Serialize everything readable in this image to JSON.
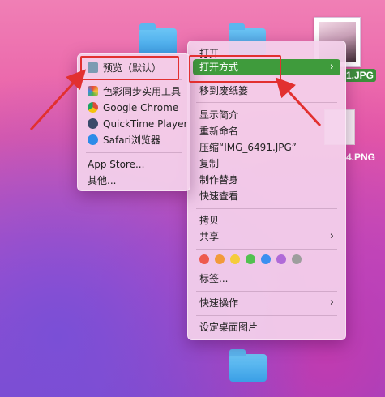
{
  "desktop": {
    "files": [
      {
        "label": "1.JPG"
      },
      {
        "label": "4.PNG"
      }
    ]
  },
  "context_menu": {
    "items": [
      {
        "label": "打开"
      },
      {
        "label": "打开方式",
        "submenu": true,
        "highlighted": true
      },
      {
        "label": "移到废纸篓"
      },
      {
        "label": "显示简介"
      },
      {
        "label": "重新命名"
      },
      {
        "label": "压缩“IMG_6491.JPG”"
      },
      {
        "label": "复制"
      },
      {
        "label": "制作替身"
      },
      {
        "label": "快速查看"
      },
      {
        "label": "拷贝"
      },
      {
        "label": "共享",
        "submenu": true
      },
      {
        "label": "标签..."
      },
      {
        "label": "快速操作",
        "submenu": true
      },
      {
        "label": "设定桌面图片"
      }
    ],
    "tag_colors": [
      "#ee5a4e",
      "#f29a3a",
      "#f5cc3c",
      "#52c150",
      "#3b8ff0",
      "#b06ad8",
      "#9e9e9e"
    ],
    "submenu_arrow": "›"
  },
  "open_with_menu": {
    "apps": [
      {
        "label": "预览（默认）",
        "icon": "preview-icon",
        "color": "#7c9bb3"
      },
      {
        "label": "色彩同步实用工具",
        "icon": "colorsync-icon",
        "color": "#e8a33a"
      },
      {
        "label": "Google Chrome",
        "icon": "chrome-icon",
        "color": "#dd4b39"
      },
      {
        "label": "QuickTime Player",
        "icon": "quicktime-icon",
        "color": "#3a4a6a"
      },
      {
        "label": "Safari浏览器",
        "icon": "safari-icon",
        "color": "#2d8be8"
      }
    ],
    "extras": [
      {
        "label": "App Store..."
      },
      {
        "label": "其他..."
      }
    ]
  },
  "annotations": {
    "color": "#e23030"
  }
}
